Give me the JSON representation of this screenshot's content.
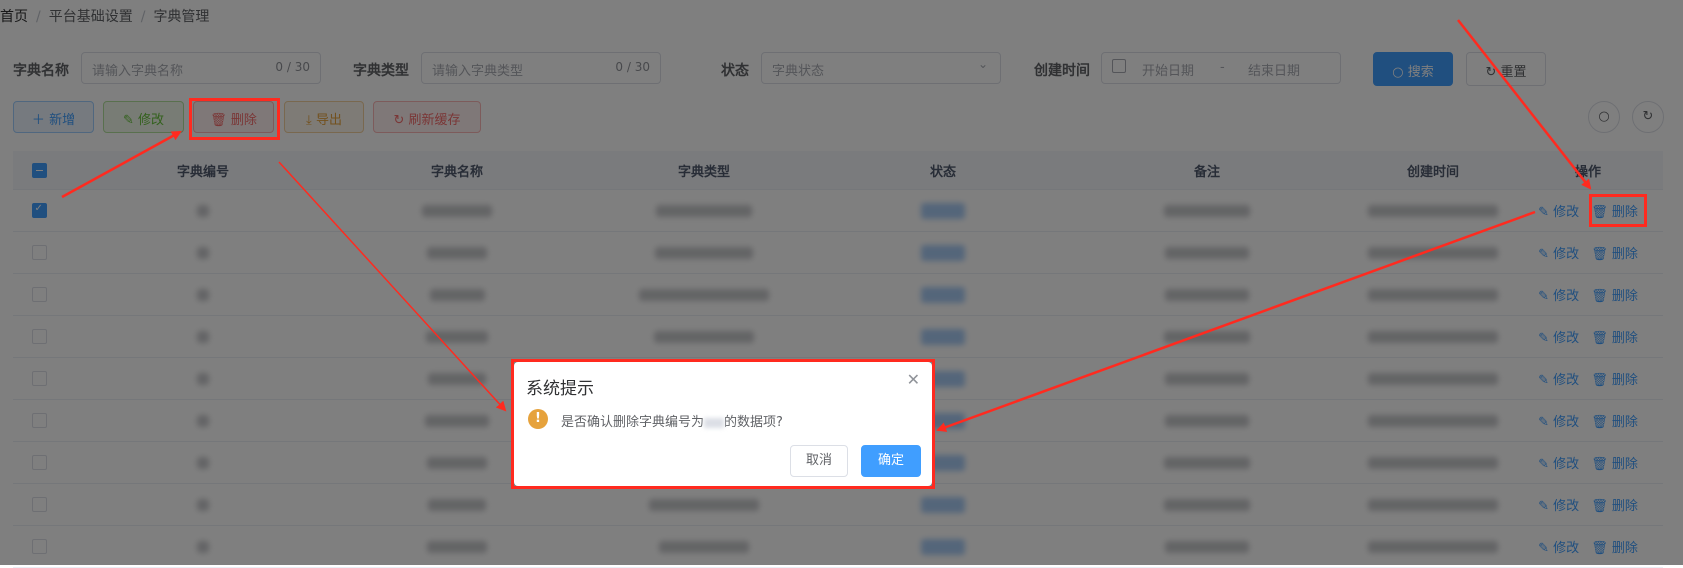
{
  "breadcrumb": {
    "home": "首页",
    "sep": "/",
    "platform": "平台基础设置",
    "current": "字典管理"
  },
  "filters": {
    "dict_name_label": "字典名称",
    "dict_name_placeholder": "请输入字典名称",
    "dict_name_count": "0 / 30",
    "dict_type_label": "字典类型",
    "dict_type_placeholder": "请输入字典类型",
    "dict_type_count": "0 / 30",
    "status_label": "状态",
    "status_placeholder": "字典状态",
    "created_label": "创建时间",
    "start_placeholder": "开始日期",
    "date_sep": "-",
    "end_placeholder": "结束日期",
    "search_label": "搜索",
    "reset_label": "重置"
  },
  "toolbar": {
    "add": "新增",
    "edit": "修改",
    "delete": "删除",
    "export": "导出",
    "refresh": "刷新缓存"
  },
  "table": {
    "headers": {
      "id": "字典编号",
      "name": "字典名称",
      "type": "字典类型",
      "status": "状态",
      "remark": "备注",
      "created": "创建时间",
      "ops": "操作"
    },
    "row_ops": {
      "edit": "修改",
      "delete": "删除"
    },
    "rows": [
      {
        "selected": true
      },
      {
        "selected": false
      },
      {
        "selected": false
      },
      {
        "selected": false
      },
      {
        "selected": false
      },
      {
        "selected": false
      },
      {
        "selected": false
      },
      {
        "selected": false
      },
      {
        "selected": false
      }
    ]
  },
  "dialog": {
    "title": "系统提示",
    "message_prefix": "是否确认删除字典编号为",
    "message_suffix": "的数据项?",
    "cancel": "取消",
    "confirm": "确定"
  },
  "colors": {
    "primary": "#409eff",
    "danger": "#f56c6c",
    "success": "#67c23a",
    "warning": "#e6a23c",
    "annotation": "#ff2a1f"
  }
}
